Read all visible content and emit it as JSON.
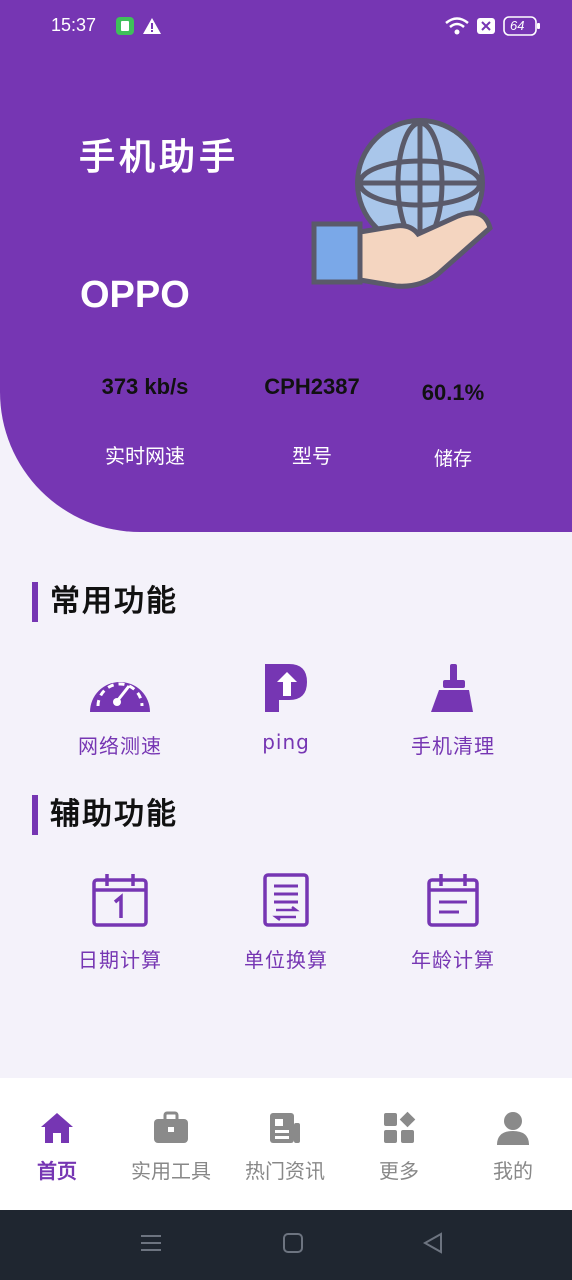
{
  "status_bar": {
    "time": "15:37",
    "battery": "64"
  },
  "header": {
    "app_title": "手机助手",
    "brand": "OPPO",
    "stats": [
      {
        "value": "373 kb/s",
        "label": "实时网速"
      },
      {
        "value": "CPH2387",
        "label": "型号"
      },
      {
        "value": "60.1%",
        "label": "储存"
      }
    ]
  },
  "sections": {
    "common": {
      "title": "常用功能",
      "items": [
        {
          "label": "网络测速",
          "icon": "speedometer-icon"
        },
        {
          "label": "ping",
          "icon": "parking-p-icon"
        },
        {
          "label": "手机清理",
          "icon": "broom-icon"
        }
      ]
    },
    "aux": {
      "title": "辅助功能",
      "items": [
        {
          "label": "日期计算",
          "icon": "calendar-icon"
        },
        {
          "label": "单位换算",
          "icon": "document-convert-icon"
        },
        {
          "label": "年龄计算",
          "icon": "calendar-lines-icon"
        }
      ]
    }
  },
  "tabbar": {
    "tabs": [
      {
        "label": "首页",
        "icon": "home-icon",
        "active": true
      },
      {
        "label": "实用工具",
        "icon": "briefcase-icon"
      },
      {
        "label": "热门资讯",
        "icon": "news-icon"
      },
      {
        "label": "更多",
        "icon": "apps-icon"
      },
      {
        "label": "我的",
        "icon": "user-icon"
      }
    ]
  },
  "colors": {
    "primary": "#7636b3",
    "background": "#f4f2fa",
    "navbar": "#1f2630"
  }
}
